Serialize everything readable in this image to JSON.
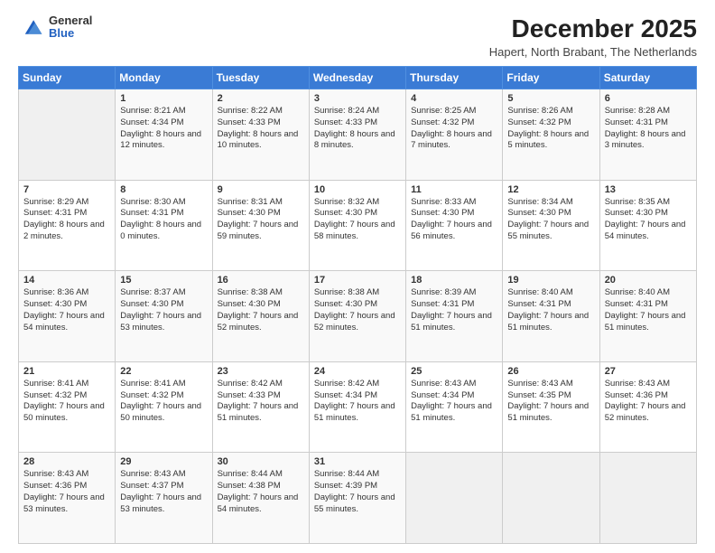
{
  "logo": {
    "general": "General",
    "blue": "Blue"
  },
  "title": "December 2025",
  "subtitle": "Hapert, North Brabant, The Netherlands",
  "calendar": {
    "headers": [
      "Sunday",
      "Monday",
      "Tuesday",
      "Wednesday",
      "Thursday",
      "Friday",
      "Saturday"
    ],
    "weeks": [
      [
        {
          "day": "",
          "empty": true
        },
        {
          "day": "1",
          "sunrise": "8:21 AM",
          "sunset": "4:34 PM",
          "daylight": "8 hours and 12 minutes."
        },
        {
          "day": "2",
          "sunrise": "8:22 AM",
          "sunset": "4:33 PM",
          "daylight": "8 hours and 10 minutes."
        },
        {
          "day": "3",
          "sunrise": "8:24 AM",
          "sunset": "4:33 PM",
          "daylight": "8 hours and 8 minutes."
        },
        {
          "day": "4",
          "sunrise": "8:25 AM",
          "sunset": "4:32 PM",
          "daylight": "8 hours and 7 minutes."
        },
        {
          "day": "5",
          "sunrise": "8:26 AM",
          "sunset": "4:32 PM",
          "daylight": "8 hours and 5 minutes."
        },
        {
          "day": "6",
          "sunrise": "8:28 AM",
          "sunset": "4:31 PM",
          "daylight": "8 hours and 3 minutes."
        }
      ],
      [
        {
          "day": "7",
          "sunrise": "8:29 AM",
          "sunset": "4:31 PM",
          "daylight": "8 hours and 2 minutes."
        },
        {
          "day": "8",
          "sunrise": "8:30 AM",
          "sunset": "4:31 PM",
          "daylight": "8 hours and 0 minutes."
        },
        {
          "day": "9",
          "sunrise": "8:31 AM",
          "sunset": "4:30 PM",
          "daylight": "7 hours and 59 minutes."
        },
        {
          "day": "10",
          "sunrise": "8:32 AM",
          "sunset": "4:30 PM",
          "daylight": "7 hours and 58 minutes."
        },
        {
          "day": "11",
          "sunrise": "8:33 AM",
          "sunset": "4:30 PM",
          "daylight": "7 hours and 56 minutes."
        },
        {
          "day": "12",
          "sunrise": "8:34 AM",
          "sunset": "4:30 PM",
          "daylight": "7 hours and 55 minutes."
        },
        {
          "day": "13",
          "sunrise": "8:35 AM",
          "sunset": "4:30 PM",
          "daylight": "7 hours and 54 minutes."
        }
      ],
      [
        {
          "day": "14",
          "sunrise": "8:36 AM",
          "sunset": "4:30 PM",
          "daylight": "7 hours and 54 minutes."
        },
        {
          "day": "15",
          "sunrise": "8:37 AM",
          "sunset": "4:30 PM",
          "daylight": "7 hours and 53 minutes."
        },
        {
          "day": "16",
          "sunrise": "8:38 AM",
          "sunset": "4:30 PM",
          "daylight": "7 hours and 52 minutes."
        },
        {
          "day": "17",
          "sunrise": "8:38 AM",
          "sunset": "4:30 PM",
          "daylight": "7 hours and 52 minutes."
        },
        {
          "day": "18",
          "sunrise": "8:39 AM",
          "sunset": "4:31 PM",
          "daylight": "7 hours and 51 minutes."
        },
        {
          "day": "19",
          "sunrise": "8:40 AM",
          "sunset": "4:31 PM",
          "daylight": "7 hours and 51 minutes."
        },
        {
          "day": "20",
          "sunrise": "8:40 AM",
          "sunset": "4:31 PM",
          "daylight": "7 hours and 51 minutes."
        }
      ],
      [
        {
          "day": "21",
          "sunrise": "8:41 AM",
          "sunset": "4:32 PM",
          "daylight": "7 hours and 50 minutes."
        },
        {
          "day": "22",
          "sunrise": "8:41 AM",
          "sunset": "4:32 PM",
          "daylight": "7 hours and 50 minutes."
        },
        {
          "day": "23",
          "sunrise": "8:42 AM",
          "sunset": "4:33 PM",
          "daylight": "7 hours and 51 minutes."
        },
        {
          "day": "24",
          "sunrise": "8:42 AM",
          "sunset": "4:34 PM",
          "daylight": "7 hours and 51 minutes."
        },
        {
          "day": "25",
          "sunrise": "8:43 AM",
          "sunset": "4:34 PM",
          "daylight": "7 hours and 51 minutes."
        },
        {
          "day": "26",
          "sunrise": "8:43 AM",
          "sunset": "4:35 PM",
          "daylight": "7 hours and 51 minutes."
        },
        {
          "day": "27",
          "sunrise": "8:43 AM",
          "sunset": "4:36 PM",
          "daylight": "7 hours and 52 minutes."
        }
      ],
      [
        {
          "day": "28",
          "sunrise": "8:43 AM",
          "sunset": "4:36 PM",
          "daylight": "7 hours and 53 minutes."
        },
        {
          "day": "29",
          "sunrise": "8:43 AM",
          "sunset": "4:37 PM",
          "daylight": "7 hours and 53 minutes."
        },
        {
          "day": "30",
          "sunrise": "8:44 AM",
          "sunset": "4:38 PM",
          "daylight": "7 hours and 54 minutes."
        },
        {
          "day": "31",
          "sunrise": "8:44 AM",
          "sunset": "4:39 PM",
          "daylight": "7 hours and 55 minutes."
        },
        {
          "day": "",
          "empty": true
        },
        {
          "day": "",
          "empty": true
        },
        {
          "day": "",
          "empty": true
        }
      ]
    ]
  }
}
